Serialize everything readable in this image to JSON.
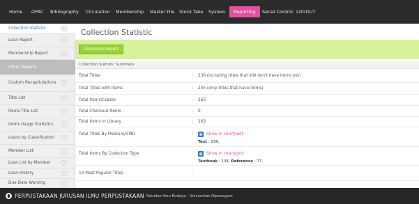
{
  "nav": {
    "items": [
      "Home",
      "OPAC",
      "Bibliography",
      "Circulation",
      "Membership",
      "Master File",
      "Stock Take",
      "System",
      "Reporting",
      "Serial Control",
      "LOGOUT"
    ],
    "active": "Reporting"
  },
  "sidebar": {
    "items": [
      {
        "label": "Collection Statistic"
      },
      {
        "label": "Loan Report"
      },
      {
        "label": "Membership Report"
      },
      {
        "label": "Other Reports"
      },
      {
        "label": "Custom Recapitulations"
      },
      {
        "label": "Title List"
      },
      {
        "label": "Items Title List"
      },
      {
        "label": "Items Usage Statistics"
      },
      {
        "label": "Loans by Classification"
      },
      {
        "label": "Member List"
      },
      {
        "label": "Loan List by Member"
      },
      {
        "label": "Loan History"
      },
      {
        "label": "Due Date Warning"
      }
    ],
    "arrow": "›"
  },
  "main": {
    "title": "Collection Statistic",
    "download_label": "Download Report",
    "summary_label": "Collection Statistic Summary",
    "rows": [
      {
        "label": "Total Titles",
        "value": "236 (including titles that still don't have items yet)"
      },
      {
        "label": "Total Titles with items",
        "value": "205 (only titles that have items)"
      },
      {
        "label": "Total Items/Copies",
        "value": "263"
      },
      {
        "label": "Total Checkout Items",
        "value": "0"
      },
      {
        "label": "Total Items In Library",
        "value": "263"
      },
      {
        "label": "Total Titles By Medium/GMD",
        "link": "Show in chart/plot",
        "detail_label": "Text",
        "detail_value": ": 236,"
      },
      {
        "label": "Total Items By Collection Type",
        "link": "Show in chart/plot",
        "detail_label": "Textbook",
        "detail_value": ": 134,",
        "detail_label2": "Reference",
        "detail_value2": ": 77,"
      },
      {
        "label": "10 Most Popular Titles",
        "value": ""
      }
    ],
    "colon": ":"
  },
  "footer": {
    "org": "PERPUSTAKAAN JURUSAN ILMU PERPUSTAKAAN",
    "faculty": "Fakultas Ilmu Budaya - Universitas Diponegoro",
    "logo_icon": "slims-logo-icon"
  },
  "colors": {
    "nav_bg": "#2b2b2b",
    "active_tab": "#e44fa0",
    "action_bar": "#d8f29a",
    "button": "#9bd23b",
    "link": "#e44fa0",
    "chart_icon": "#3a7fc8"
  }
}
